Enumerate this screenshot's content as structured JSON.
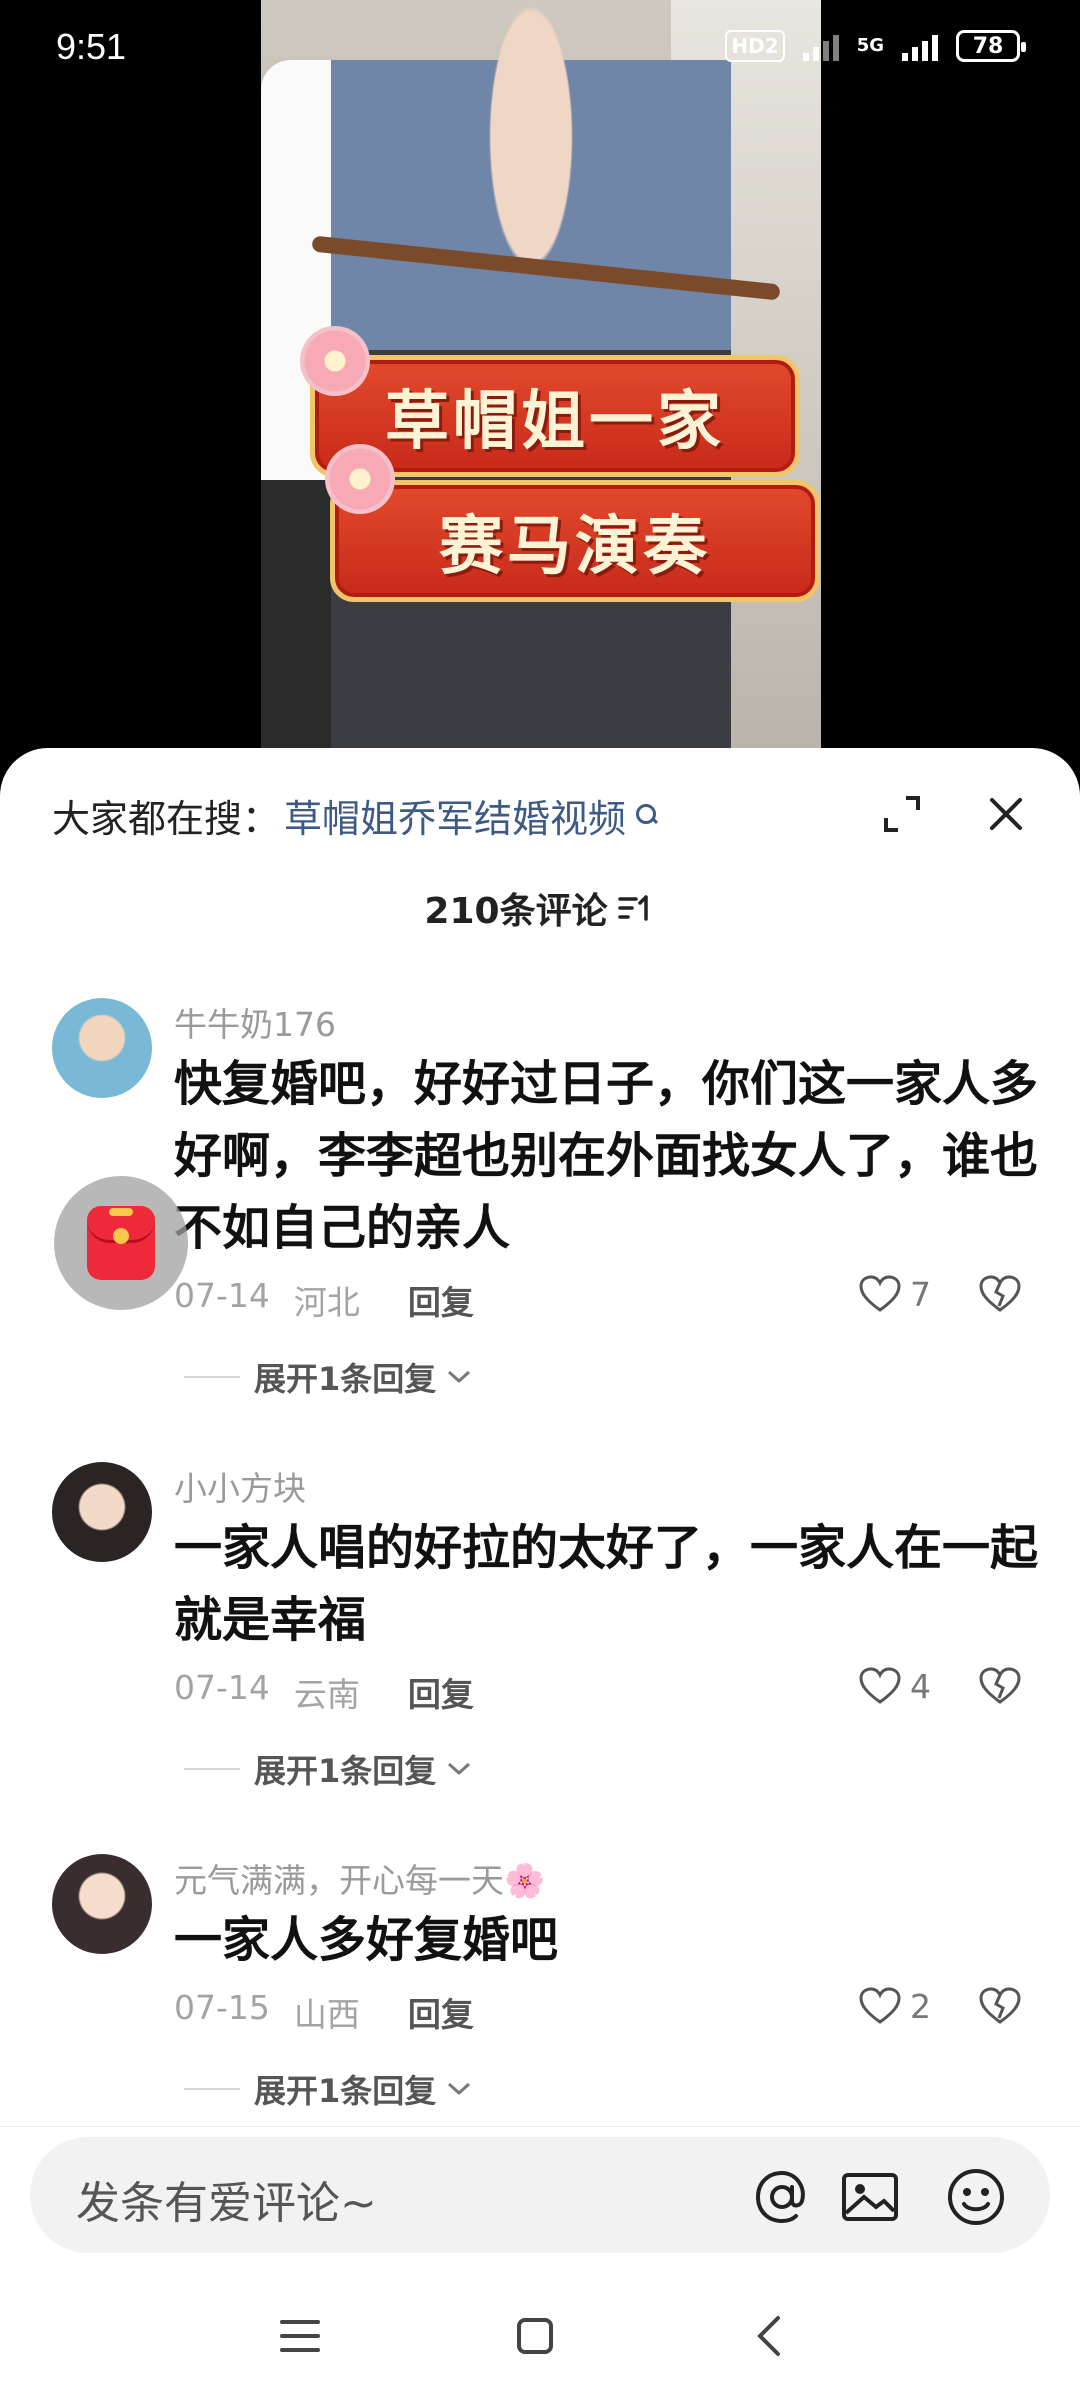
{
  "status_bar": {
    "time": "9:51",
    "hd": "HD2",
    "network": "5G",
    "battery": "78"
  },
  "video": {
    "banner_line1": "草帽姐一家",
    "banner_line2": "赛马演奏"
  },
  "sheet": {
    "search_prefix": "大家都在搜：",
    "search_query": "草帽姐乔军结婚视频",
    "title": "210条评论"
  },
  "comments": [
    {
      "username": "牛牛奶176",
      "text": "快复婚吧，好好过日子，你们这一家人多好啊，李李超也别在外面找女人了，谁也不如自己的亲人",
      "date": "07-14",
      "location": "河北",
      "reply_label": "回复",
      "likes": "7",
      "expand_label": "展开1条回复"
    },
    {
      "username": "小小方块",
      "text": "一家人唱的好拉的太好了，一家人在一起就是幸福",
      "date": "07-14",
      "location": "云南",
      "reply_label": "回复",
      "likes": "4",
      "expand_label": "展开1条回复"
    },
    {
      "username": "元气满满，开心每一天🌸",
      "text": "一家人多好复婚吧",
      "date": "07-15",
      "location": "山西",
      "reply_label": "回复",
      "likes": "2",
      "expand_label": "展开1条回复"
    }
  ],
  "input": {
    "placeholder": "发条有爱评论~"
  },
  "icons": {
    "expand": "expand-icon",
    "close": "close-icon",
    "sort": "sort-icon",
    "like": "heart-icon",
    "dislike": "broken-heart-icon",
    "at": "at-icon",
    "image": "image-icon",
    "emoji": "emoji-icon",
    "red_packet": "red-packet-icon"
  },
  "colors": {
    "link": "#3d5a87",
    "muted": "#9a9a9a",
    "banner_red": "#d2321f"
  }
}
